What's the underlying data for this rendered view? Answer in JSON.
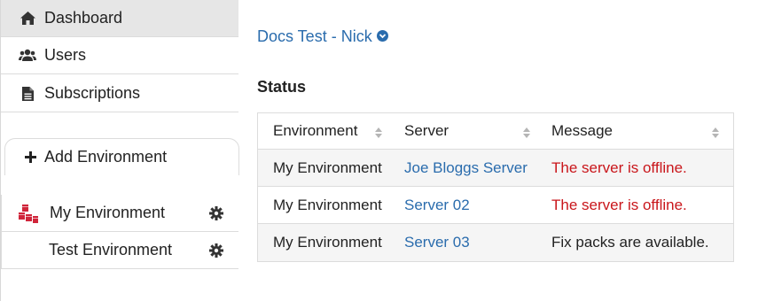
{
  "sidebar": {
    "nav": [
      {
        "label": "Dashboard",
        "icon": "home-icon",
        "active": true
      },
      {
        "label": "Users",
        "icon": "users-icon",
        "active": false
      },
      {
        "label": "Subscriptions",
        "icon": "document-icon",
        "active": false
      }
    ],
    "add_environment_label": "Add Environment",
    "environments": [
      {
        "label": "My Environment",
        "icon": "environment-cubes-icon"
      },
      {
        "label": "Test Environment",
        "icon": ""
      }
    ]
  },
  "main": {
    "org_name": "Docs Test - Nick",
    "status_title": "Status",
    "table": {
      "columns": [
        "Environment",
        "Server",
        "Message"
      ],
      "rows": [
        {
          "environment": "My Environment",
          "server": "Joe Bloggs Server",
          "message": "The server is offline.",
          "message_status": "error"
        },
        {
          "environment": "My Environment",
          "server": "Server 02",
          "message": "The server is offline.",
          "message_status": "error"
        },
        {
          "environment": "My Environment",
          "server": "Server 03",
          "message": "Fix packs are available.",
          "message_status": "info"
        }
      ]
    }
  },
  "colors": {
    "link": "#2a6cad",
    "error": "#c9161b",
    "active_nav_bg": "#e6e6e6",
    "environment_icon": "#d0253a"
  }
}
